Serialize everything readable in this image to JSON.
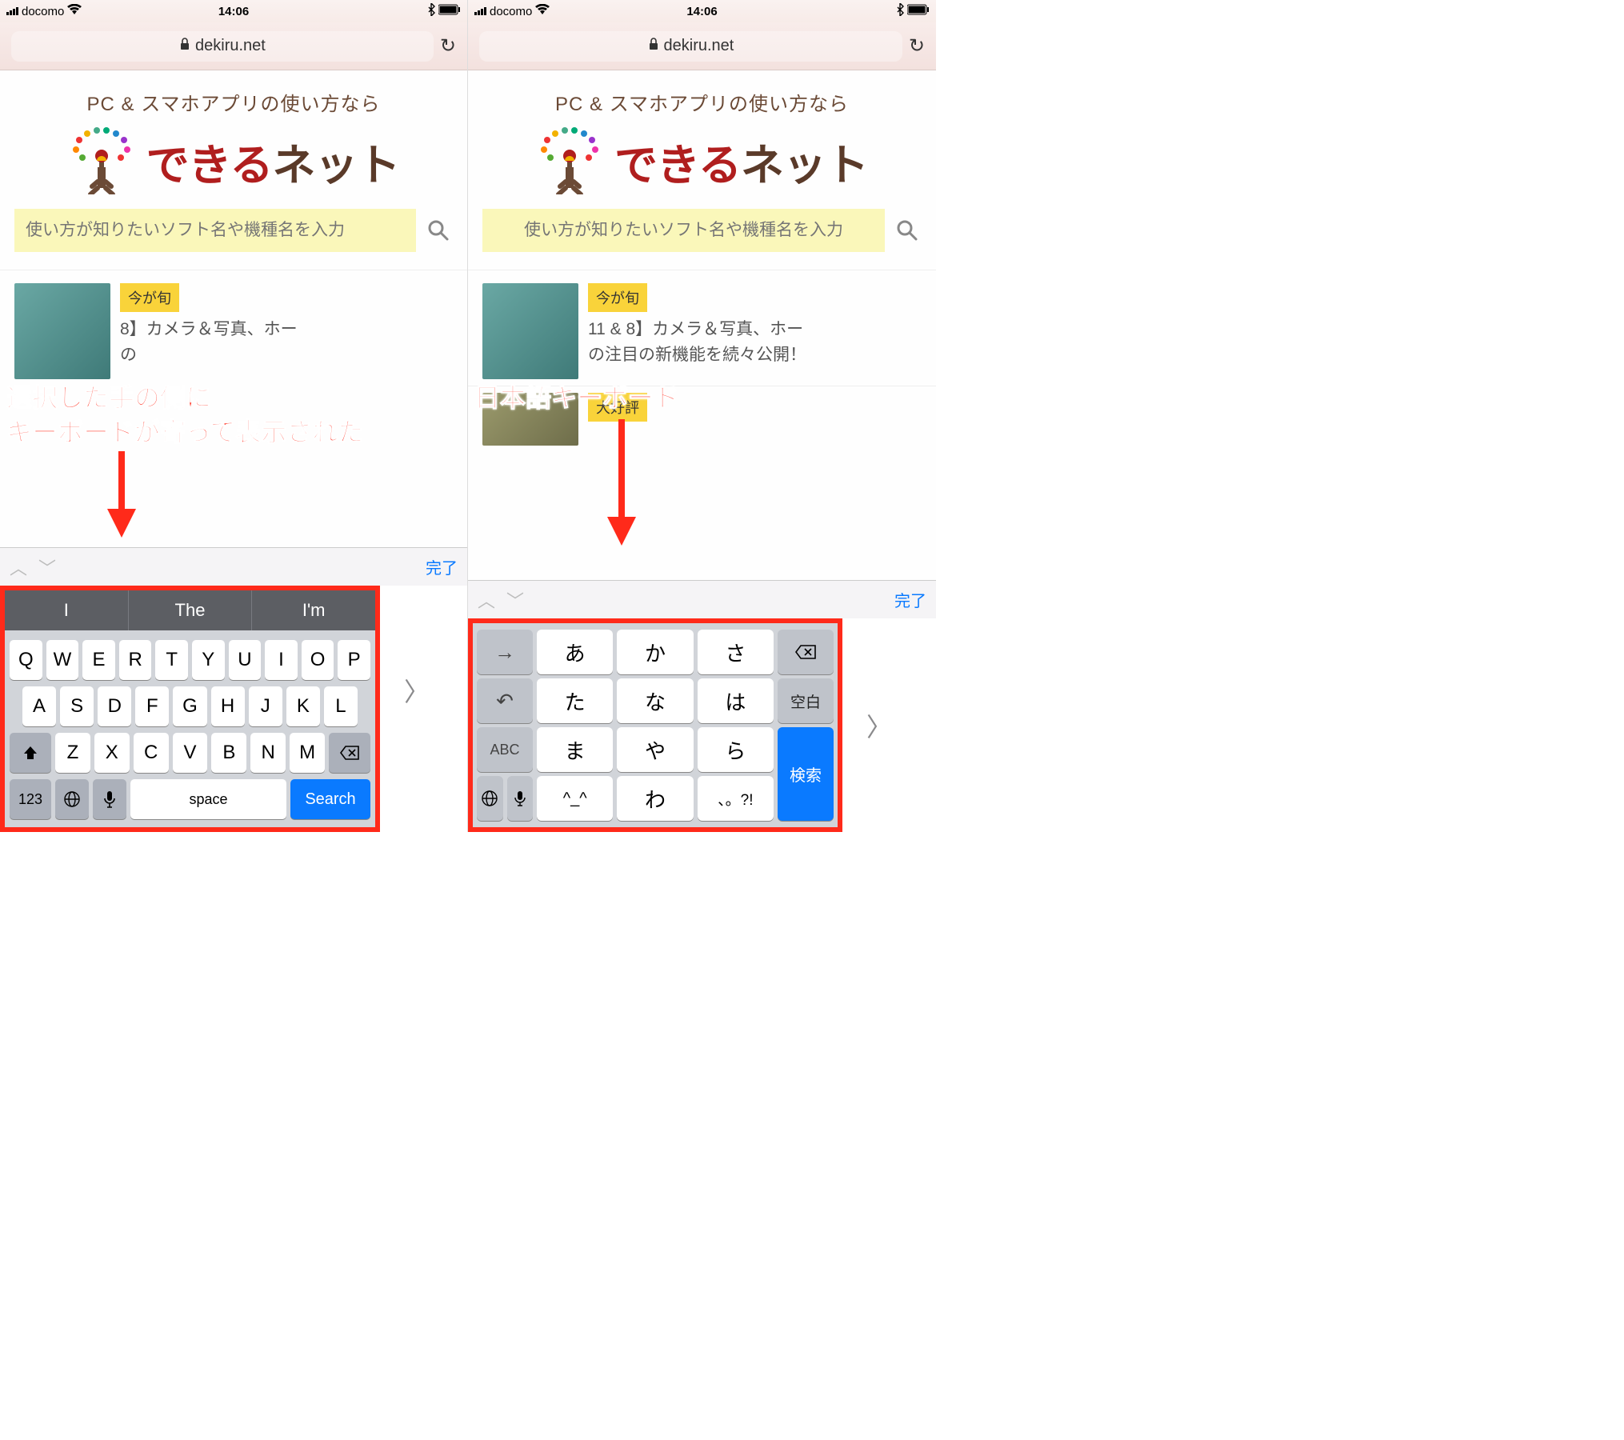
{
  "statusbar": {
    "carrier": "docomo",
    "time": "14:06"
  },
  "urlbar": {
    "domain": "dekiru.net"
  },
  "page": {
    "tagline": "PC & スマホアプリの使い方なら",
    "logo_red": "できる",
    "logo_brown": "ネット",
    "search_placeholder": "使い方が知りたいソフト名や機種名を入力"
  },
  "articles": {
    "tag1": "今が旬",
    "title1a": "8】カメラ＆写真、ホー",
    "title1b_left": "の",
    "title2a": "11 &",
    "title2b": "8】カメラ＆写真、ホー",
    "title2c": "の注目の新機能を続々公開！",
    "tag2": "大好評"
  },
  "keyboard": {
    "done": "完了",
    "suggest": [
      "I",
      "The",
      "I'm"
    ],
    "row1": [
      "Q",
      "W",
      "E",
      "R",
      "T",
      "Y",
      "U",
      "I",
      "O",
      "P"
    ],
    "row2": [
      "A",
      "S",
      "D",
      "F",
      "G",
      "H",
      "J",
      "K",
      "L"
    ],
    "row3": [
      "Z",
      "X",
      "C",
      "V",
      "B",
      "N",
      "M"
    ],
    "numswitch": "123",
    "space": "space",
    "search": "Search"
  },
  "jp": {
    "keys": {
      "a": "あ",
      "ka": "か",
      "sa": "さ",
      "ta": "た",
      "na": "な",
      "ha": "は",
      "ma": "ま",
      "ya": "や",
      "ra": "ら",
      "wa": "わ",
      "komoji": "^_^",
      "punc": "、。?!"
    },
    "abc": "ABC",
    "kuuhaku": "空白",
    "search": "検索"
  },
  "annotations": {
    "left_line1": "選択した手の側に",
    "left_line2": "キーボードが寄って表示された",
    "right_line1": "日本語キーボード"
  }
}
